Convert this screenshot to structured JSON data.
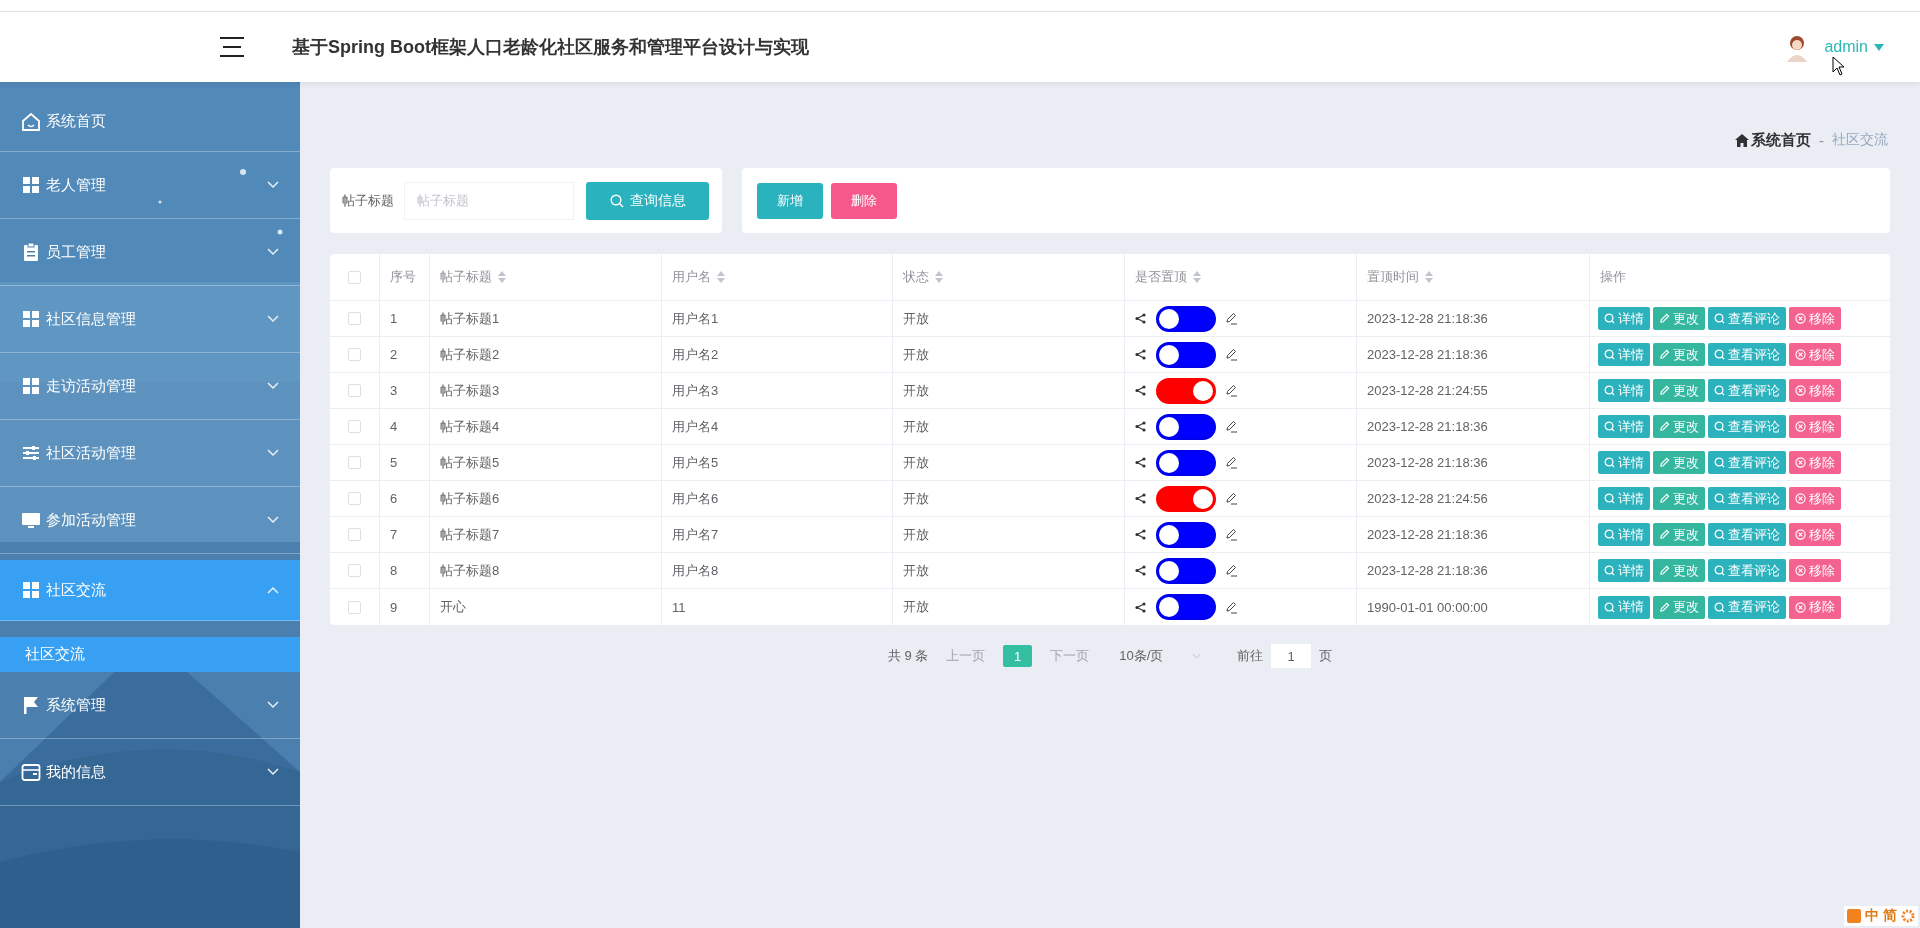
{
  "header": {
    "title": "基于Spring Boot框架人口老龄化社区服务和管理平台设计与实现",
    "user": "admin"
  },
  "sidebar": {
    "items": [
      {
        "label": "系统首页",
        "kind": "link",
        "selected": false
      },
      {
        "label": "老人管理",
        "kind": "menu",
        "selected": false,
        "expanded": false
      },
      {
        "label": "员工管理",
        "kind": "menu",
        "selected": false,
        "expanded": false
      },
      {
        "label": "社区信息管理",
        "kind": "menu",
        "selected": false,
        "expanded": false
      },
      {
        "label": "走访活动管理",
        "kind": "menu",
        "selected": false,
        "expanded": false
      },
      {
        "label": "社区活动管理",
        "kind": "menu",
        "selected": false,
        "expanded": false
      },
      {
        "label": "参加活动管理",
        "kind": "menu",
        "selected": false,
        "expanded": false
      },
      {
        "label": "社区交流",
        "kind": "menu",
        "selected": true,
        "expanded": true,
        "children": [
          {
            "label": "社区交流",
            "selected": true
          }
        ]
      },
      {
        "label": "系统管理",
        "kind": "menu",
        "selected": false,
        "expanded": false
      },
      {
        "label": "我的信息",
        "kind": "menu",
        "selected": false,
        "expanded": false
      }
    ]
  },
  "breadcrumb": {
    "items": [
      "系统首页",
      "社区交流"
    ],
    "separator": "-"
  },
  "search": {
    "label": "帖子标题",
    "placeholder": "帖子标题",
    "button": "查询信息"
  },
  "actions": [
    {
      "label": "新增",
      "kind": "add"
    },
    {
      "label": "删除",
      "kind": "delete"
    }
  ],
  "table": {
    "all_checked": false,
    "columns": [
      {
        "label": "序号",
        "sortable": false
      },
      {
        "label": "帖子标题",
        "sortable": true
      },
      {
        "label": "用户名",
        "sortable": true
      },
      {
        "label": "状态",
        "sortable": true
      },
      {
        "label": "是否置顶",
        "sortable": true
      },
      {
        "label": "置顶时间",
        "sortable": true
      },
      {
        "label": "操作",
        "sortable": false
      }
    ],
    "rows": [
      {
        "checked": false,
        "index": "1",
        "title": "帖子标题1",
        "user": "用户名1",
        "status": "开放",
        "pinned": false,
        "pin_time": "2023-12-28 21:18:36",
        "actions": [
          "详情",
          "更改",
          "查看评论",
          "移除"
        ]
      },
      {
        "checked": false,
        "index": "2",
        "title": "帖子标题2",
        "user": "用户名2",
        "status": "开放",
        "pinned": false,
        "pin_time": "2023-12-28 21:18:36",
        "actions": [
          "详情",
          "更改",
          "查看评论",
          "移除"
        ]
      },
      {
        "checked": false,
        "index": "3",
        "title": "帖子标题3",
        "user": "用户名3",
        "status": "开放",
        "pinned": true,
        "pin_time": "2023-12-28 21:24:55",
        "actions": [
          "详情",
          "更改",
          "查看评论",
          "移除"
        ]
      },
      {
        "checked": false,
        "index": "4",
        "title": "帖子标题4",
        "user": "用户名4",
        "status": "开放",
        "pinned": false,
        "pin_time": "2023-12-28 21:18:36",
        "actions": [
          "详情",
          "更改",
          "查看评论",
          "移除"
        ]
      },
      {
        "checked": false,
        "index": "5",
        "title": "帖子标题5",
        "user": "用户名5",
        "status": "开放",
        "pinned": false,
        "pin_time": "2023-12-28 21:18:36",
        "actions": [
          "详情",
          "更改",
          "查看评论",
          "移除"
        ]
      },
      {
        "checked": false,
        "index": "6",
        "title": "帖子标题6",
        "user": "用户名6",
        "status": "开放",
        "pinned": true,
        "pin_time": "2023-12-28 21:24:56",
        "actions": [
          "详情",
          "更改",
          "查看评论",
          "移除"
        ]
      },
      {
        "checked": false,
        "index": "7",
        "title": "帖子标题7",
        "user": "用户名7",
        "status": "开放",
        "pinned": false,
        "pin_time": "2023-12-28 21:18:36",
        "actions": [
          "详情",
          "更改",
          "查看评论",
          "移除"
        ]
      },
      {
        "checked": false,
        "index": "8",
        "title": "帖子标题8",
        "user": "用户名8",
        "status": "开放",
        "pinned": false,
        "pin_time": "2023-12-28 21:18:36",
        "actions": [
          "详情",
          "更改",
          "查看评论",
          "移除"
        ]
      },
      {
        "checked": false,
        "index": "9",
        "title": "开心",
        "user": "11",
        "status": "开放",
        "pinned": false,
        "pin_time": "1990-01-01 00:00:00",
        "actions": [
          "详情",
          "更改",
          "查看评论",
          "移除"
        ]
      }
    ]
  },
  "pagination": {
    "total": "共 9 条",
    "prev": "上一页",
    "pages": [
      {
        "label": "1",
        "selected": true
      }
    ],
    "next": "下一页",
    "page_size": "10条/页",
    "goto": "前往",
    "goto_value": "1",
    "page_unit": "页"
  },
  "ime_bar": {
    "items": [
      "中",
      "简"
    ]
  }
}
